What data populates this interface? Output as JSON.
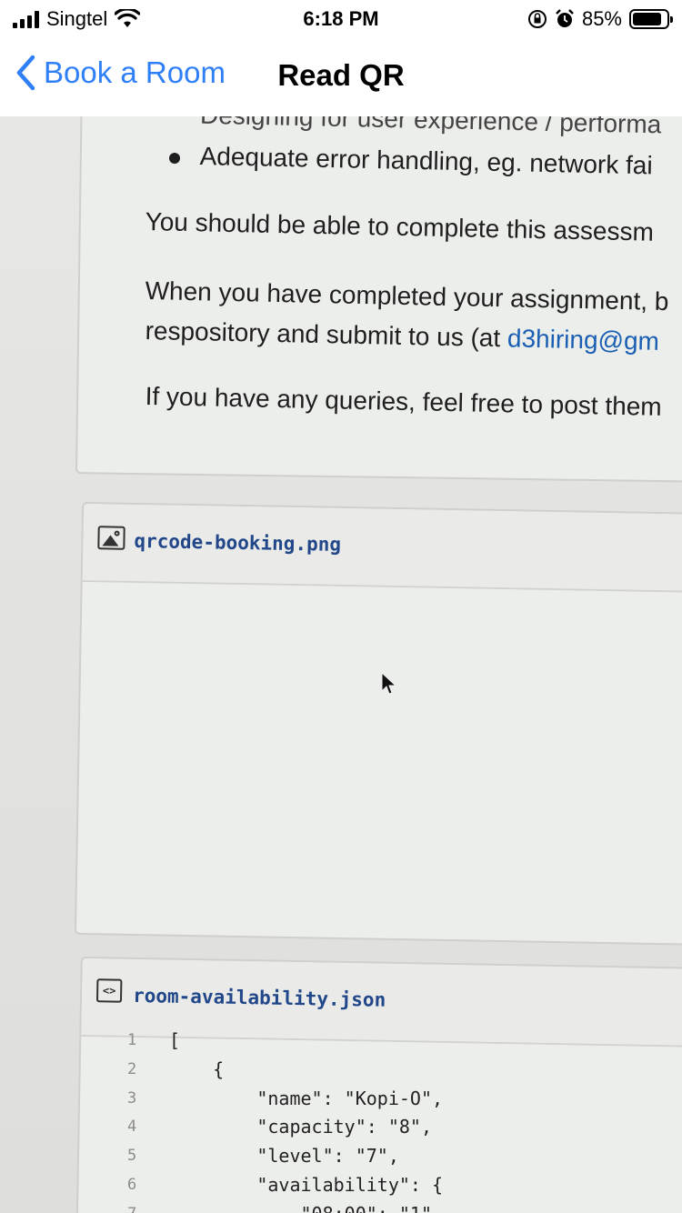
{
  "status_bar": {
    "carrier": "Singtel",
    "time": "6:18 PM",
    "battery_percent": "85%",
    "battery_level": 0.85
  },
  "nav": {
    "back_label": "Book a Room",
    "title": "Read QR"
  },
  "document": {
    "cut_line": "Designing for user experience / performa",
    "bullet_text": "Adequate error handling, eg. network fai",
    "para1": "You should be able to complete this assessm",
    "para2_line1": "When you have completed your assignment, b",
    "para2_line2_prefix": "respository and submit to us (at ",
    "para2_link": "d3hiring@gm",
    "para3": "If you have any queries, feel free to post them",
    "image_file_name": "qrcode-booking.png",
    "json_file_name": "room-availability.json",
    "code_lines": [
      {
        "no": "1",
        "text": "["
      },
      {
        "no": "2",
        "text": "    {"
      },
      {
        "no": "3",
        "text": "        \"name\": \"Kopi-O\","
      },
      {
        "no": "4",
        "text": "        \"capacity\": \"8\","
      },
      {
        "no": "5",
        "text": "        \"level\": \"7\","
      },
      {
        "no": "6",
        "text": "        \"availability\": {"
      },
      {
        "no": "7",
        "text": "            \"08:00\": \"1\""
      }
    ]
  },
  "icons": {
    "back": "chevron-left-icon",
    "wifi": "wifi-icon",
    "lock": "orientation-lock-icon",
    "alarm": "alarm-icon",
    "image_file": "image-file-icon",
    "code_file": "code-file-icon",
    "cursor": "mouse-pointer-icon"
  },
  "colors": {
    "ios_blue": "#2f7ff6",
    "link_blue": "#1a5fb4",
    "file_name": "#21478a"
  }
}
